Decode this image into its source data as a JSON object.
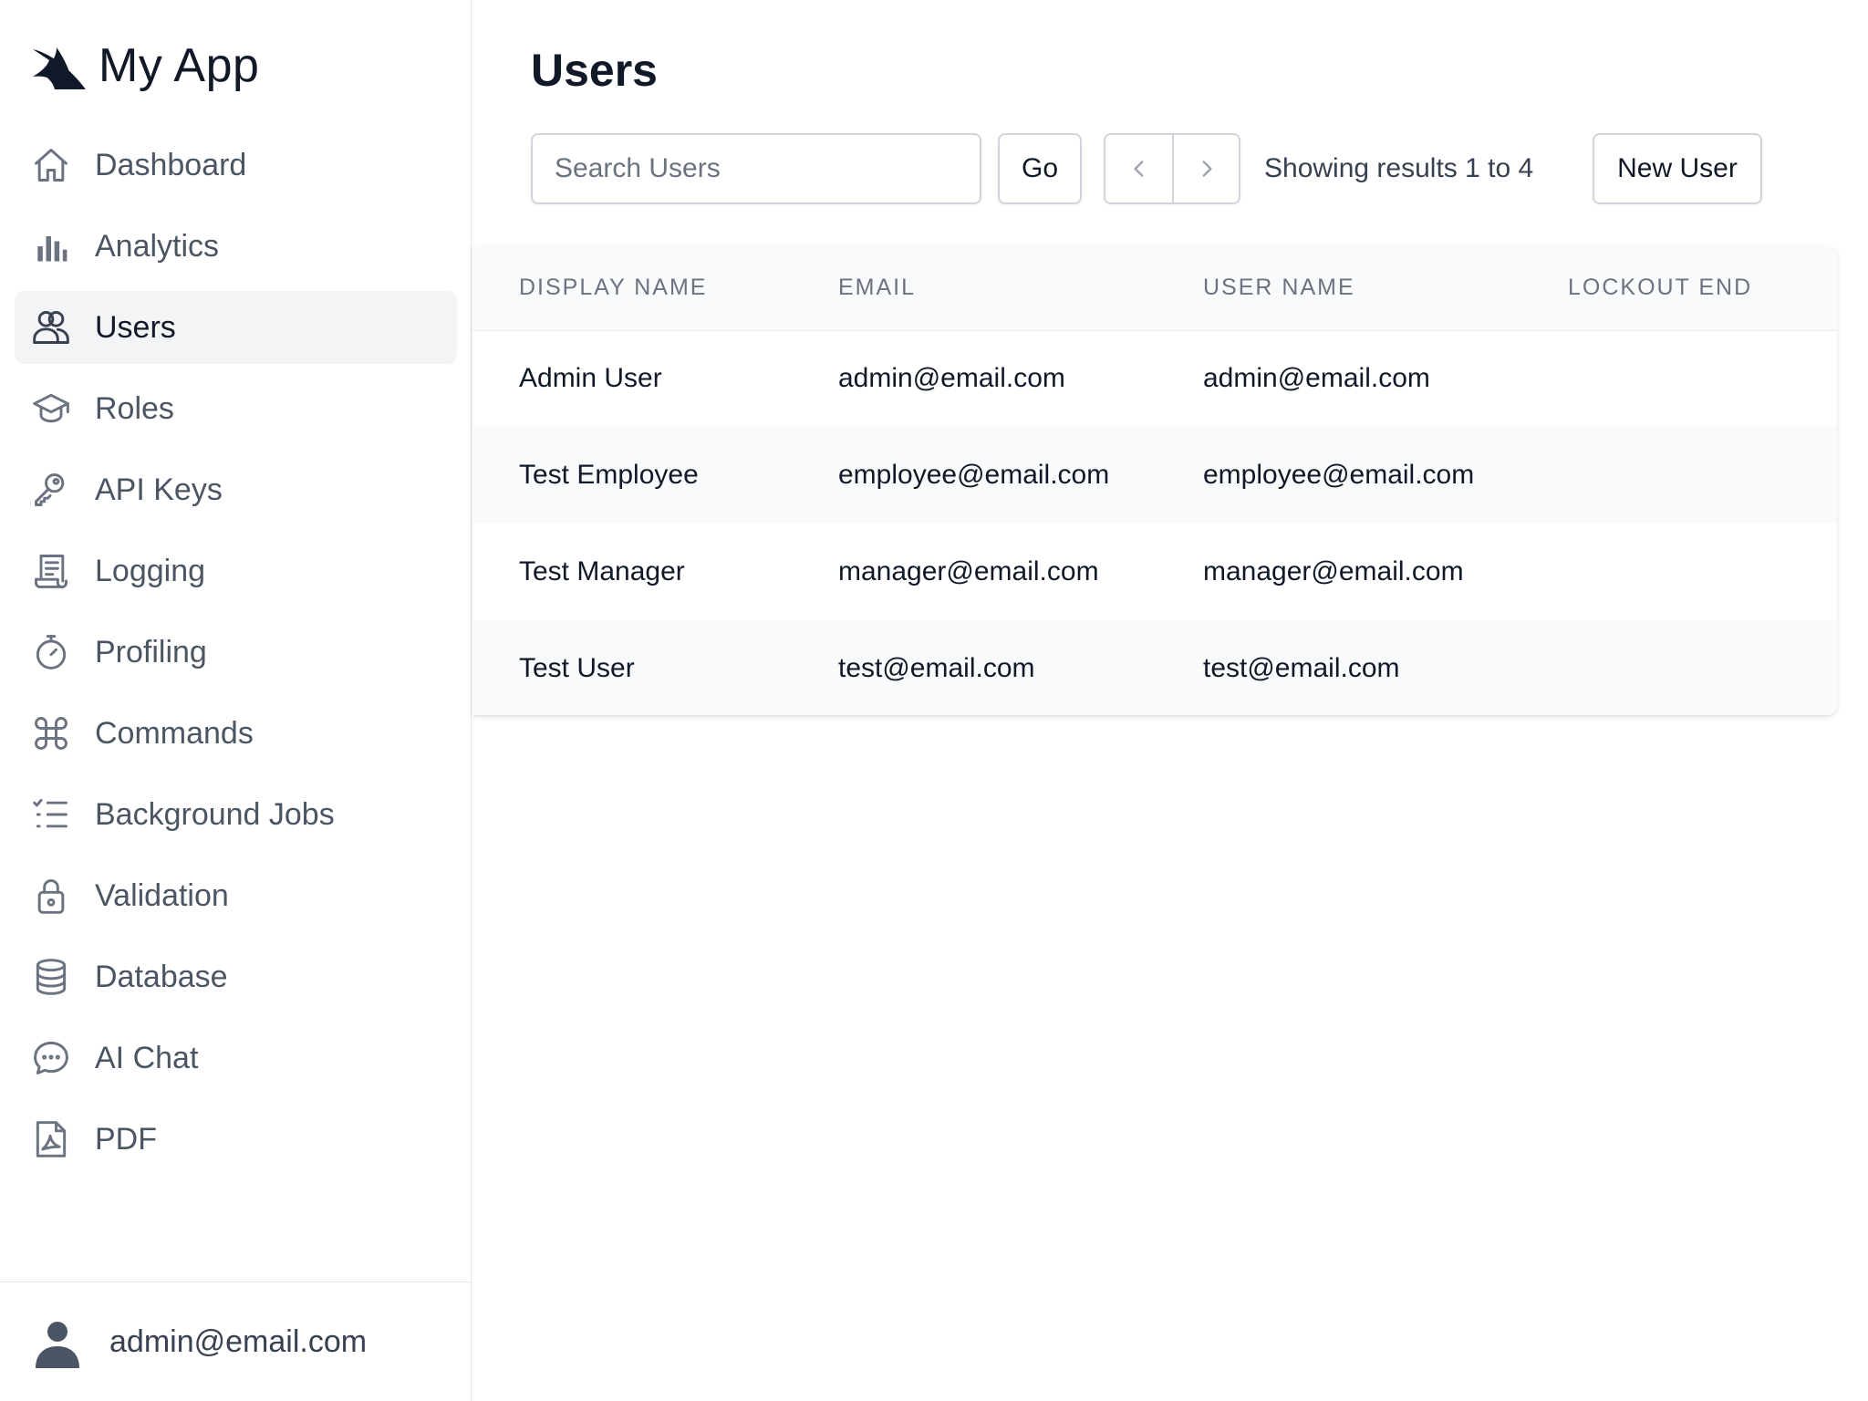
{
  "app": {
    "name": "My App"
  },
  "sidebar": {
    "items": [
      {
        "label": "Dashboard",
        "icon": "home-icon",
        "active": false
      },
      {
        "label": "Analytics",
        "icon": "bar-chart-icon",
        "active": false
      },
      {
        "label": "Users",
        "icon": "users-icon",
        "active": true
      },
      {
        "label": "Roles",
        "icon": "graduation-cap-icon",
        "active": false
      },
      {
        "label": "API Keys",
        "icon": "key-icon",
        "active": false
      },
      {
        "label": "Logging",
        "icon": "scroll-icon",
        "active": false
      },
      {
        "label": "Profiling",
        "icon": "stopwatch-icon",
        "active": false
      },
      {
        "label": "Commands",
        "icon": "command-icon",
        "active": false
      },
      {
        "label": "Background Jobs",
        "icon": "checklist-icon",
        "active": false
      },
      {
        "label": "Validation",
        "icon": "lock-icon",
        "active": false
      },
      {
        "label": "Database",
        "icon": "database-icon",
        "active": false
      },
      {
        "label": "AI Chat",
        "icon": "chat-bubble-icon",
        "active": false
      },
      {
        "label": "PDF",
        "icon": "pdf-file-icon",
        "active": false
      }
    ]
  },
  "user": {
    "email": "admin@email.com"
  },
  "main": {
    "title": "Users",
    "search": {
      "placeholder": "Search Users",
      "value": ""
    },
    "go_label": "Go",
    "results_text": "Showing results 1 to 4",
    "new_user_label": "New User"
  },
  "table": {
    "columns": [
      "DISPLAY NAME",
      "EMAIL",
      "USER NAME",
      "LOCKOUT END"
    ],
    "rows": [
      [
        "Admin User",
        "admin@email.com",
        "admin@email.com",
        ""
      ],
      [
        "Test Employee",
        "employee@email.com",
        "employee@email.com",
        ""
      ],
      [
        "Test Manager",
        "manager@email.com",
        "manager@email.com",
        ""
      ],
      [
        "Test User",
        "test@email.com",
        "test@email.com",
        ""
      ]
    ]
  },
  "colors": {
    "active_nav_bg": "#f3f4f6",
    "border": "#d1d5db",
    "muted_text": "#6b7280",
    "text": "#111827"
  }
}
